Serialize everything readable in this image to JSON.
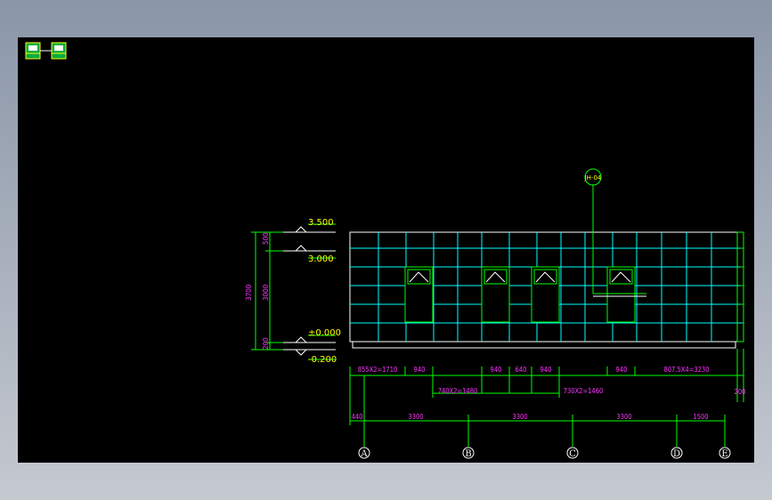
{
  "elevations": {
    "top": "3.500",
    "roof": "3.000",
    "floor": "±0.000",
    "ground": "-0.200"
  },
  "vertical_dims": {
    "total": "3700",
    "top_seg": "500",
    "mid_seg": "3000",
    "bottom_seg": "200"
  },
  "callout": "JH-04",
  "dims_row1": [
    "855X2=1710",
    "940",
    "940",
    "640",
    "940",
    "940",
    "807.5X4=3230"
  ],
  "dims_row1_end": "200",
  "dims_row2": [
    "740X2=1480",
    "730X2=1460"
  ],
  "axis_dims": [
    "440",
    "3300",
    "3300",
    "3300",
    "1500"
  ],
  "axes": [
    "A",
    "B",
    "C",
    "D",
    "E"
  ],
  "colors": {
    "background": "#000000",
    "frame": "#00ff00",
    "grid": "#00ffff",
    "dimension_text": "#ff33ff",
    "axis_label": "#ffffff"
  }
}
